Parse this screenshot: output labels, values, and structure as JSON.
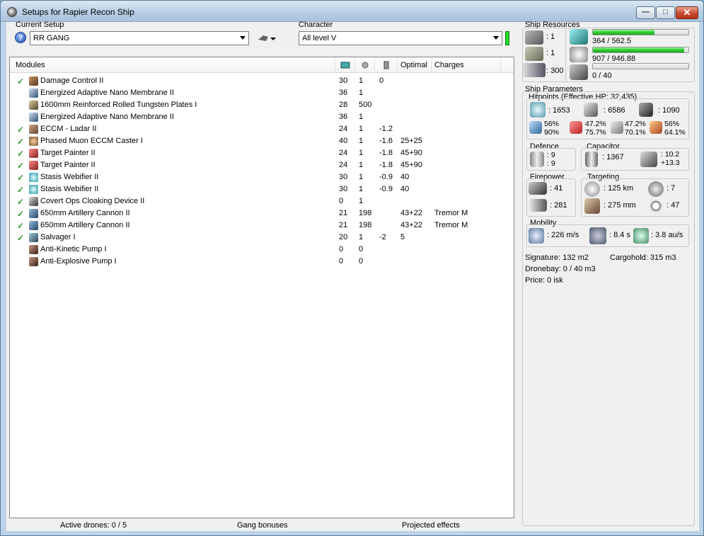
{
  "window": {
    "title": "Setups for Rapier Recon Ship"
  },
  "setup": {
    "current_label": "Current Setup",
    "current_value": "RR GANG",
    "character_label": "Character",
    "character_value": "All level V"
  },
  "modules": {
    "headers": {
      "name": "Modules",
      "optimal": "Optimal",
      "charges": "Charges"
    },
    "header_icons": [
      "cpu-icon",
      "powergrid-icon",
      "capacitor-need-icon"
    ],
    "rows": [
      {
        "checked": true,
        "icon": "damage-control-icon",
        "name": "Damage Control II",
        "cpu": "30",
        "pg": "1",
        "cap": "0",
        "optimal": "",
        "charges": ""
      },
      {
        "checked": false,
        "icon": "membrane-icon",
        "name": "Energized Adaptive Nano Membrane II",
        "cpu": "36",
        "pg": "1",
        "cap": "",
        "optimal": "",
        "charges": ""
      },
      {
        "checked": false,
        "icon": "armor-plate-icon",
        "name": "1600mm Reinforced Rolled Tungsten Plates I",
        "cpu": "28",
        "pg": "500",
        "cap": "",
        "optimal": "",
        "charges": ""
      },
      {
        "checked": false,
        "icon": "membrane-icon",
        "name": "Energized Adaptive Nano Membrane II",
        "cpu": "36",
        "pg": "1",
        "cap": "",
        "optimal": "",
        "charges": ""
      },
      {
        "checked": true,
        "icon": "eccm-icon",
        "name": "ECCM - Ladar II",
        "cpu": "24",
        "pg": "1",
        "cap": "-1.2",
        "optimal": "",
        "charges": ""
      },
      {
        "checked": true,
        "icon": "muon-caster-icon",
        "name": "Phased Muon ECCM Caster I",
        "cpu": "40",
        "pg": "1",
        "cap": "-1.6",
        "optimal": "25+25",
        "charges": ""
      },
      {
        "checked": true,
        "icon": "target-painter-icon",
        "name": "Target Painter II",
        "cpu": "24",
        "pg": "1",
        "cap": "-1.8",
        "optimal": "45+90",
        "charges": ""
      },
      {
        "checked": true,
        "icon": "target-painter-icon",
        "name": "Target Painter II",
        "cpu": "24",
        "pg": "1",
        "cap": "-1.8",
        "optimal": "45+90",
        "charges": ""
      },
      {
        "checked": true,
        "icon": "stasis-webifier-icon",
        "name": "Stasis Webifier II",
        "cpu": "30",
        "pg": "1",
        "cap": "-0.9",
        "optimal": "40",
        "charges": ""
      },
      {
        "checked": true,
        "icon": "stasis-webifier-icon",
        "name": "Stasis Webifier II",
        "cpu": "30",
        "pg": "1",
        "cap": "-0.9",
        "optimal": "40",
        "charges": ""
      },
      {
        "checked": true,
        "icon": "cloaking-device-icon",
        "name": "Covert Ops Cloaking Device II",
        "cpu": "0",
        "pg": "1",
        "cap": "",
        "optimal": "",
        "charges": ""
      },
      {
        "checked": true,
        "icon": "artillery-icon",
        "name": "650mm Artillery Cannon II",
        "cpu": "21",
        "pg": "198",
        "cap": "",
        "optimal": "43+22",
        "charges": "Tremor M"
      },
      {
        "checked": true,
        "icon": "artillery-icon",
        "name": "650mm Artillery Cannon II",
        "cpu": "21",
        "pg": "198",
        "cap": "",
        "optimal": "43+22",
        "charges": "Tremor M"
      },
      {
        "checked": true,
        "icon": "salvager-icon",
        "name": "Salvager I",
        "cpu": "20",
        "pg": "1",
        "cap": "-2",
        "optimal": "5",
        "charges": ""
      },
      {
        "checked": false,
        "icon": "rig-icon",
        "name": "Anti-Kinetic Pump I",
        "cpu": "0",
        "pg": "0",
        "cap": "",
        "optimal": "",
        "charges": ""
      },
      {
        "checked": false,
        "icon": "rig-icon",
        "name": "Anti-Explosive Pump I",
        "cpu": "0",
        "pg": "0",
        "cap": "",
        "optimal": "",
        "charges": ""
      }
    ]
  },
  "status": {
    "drones": "Active drones: 0 / 5",
    "gang": "Gang bonuses",
    "projected": "Projected effects"
  },
  "resources": {
    "label": "Ship Resources",
    "turret_slots": "1",
    "launcher_slots": "1",
    "calibration": "300",
    "cpu": "364 / 562.5",
    "cpu_fill": 0.647,
    "powergrid": "907 / 946.88",
    "powergrid_fill": 0.958,
    "dronebay": "0 / 40",
    "dronebay_fill": 0
  },
  "params": {
    "label": "Ship Parameters",
    "hitpoints_label": "Hitpoints (Effective HP: 32,435)",
    "shield_hp": ": 1653",
    "armor_hp": ": 6586",
    "hull_hp": ": 1090",
    "res_em": [
      "56%",
      "90%"
    ],
    "res_thermal": [
      "47.2%",
      "75.7%"
    ],
    "res_kinetic": [
      "47.2%",
      "70.1%"
    ],
    "res_explosive": [
      "56%",
      "64.1%"
    ],
    "defence_label": "Defence",
    "defence_vals": [
      ": 9",
      ": 9"
    ],
    "capacitor_label": "Capacitor",
    "capacitor_amount": ": 1367",
    "capacitor_delta": [
      ": 10.2",
      "+13.3"
    ],
    "firepower_label": "Firepower",
    "firepower_vals": [
      ": 41",
      ": 281"
    ],
    "targeting_label": "Targeting",
    "target_range": ": 125 km",
    "target_count": ": 7",
    "scan_res": ": 275 mm",
    "sensor_str": ": 47",
    "mobility_label": "Mobility",
    "speed": ": 226 m/s",
    "align": ": 8.4 s",
    "warp": ": 3.8 au/s",
    "signature": "Signature: 132 m2",
    "cargohold": "Cargohold: 315 m3",
    "dronebay": "Dronebay: 0 / 40 m3",
    "price": "Price: 0 isk"
  }
}
